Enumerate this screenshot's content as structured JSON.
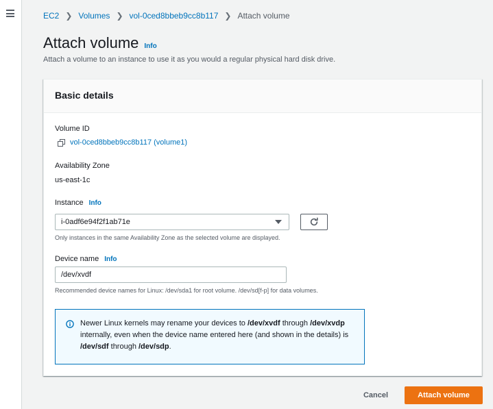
{
  "breadcrumb": [
    {
      "label": "EC2",
      "link": true
    },
    {
      "label": "Volumes",
      "link": true
    },
    {
      "label": "vol-0ced8bbeb9cc8b117",
      "link": true
    },
    {
      "label": "Attach volume",
      "link": false
    }
  ],
  "page": {
    "title": "Attach volume",
    "info": "Info",
    "description": "Attach a volume to an instance to use it as you would a regular physical hard disk drive."
  },
  "panel": {
    "title": "Basic details",
    "volume_id_label": "Volume ID",
    "volume_id_value": "vol-0ced8bbeb9cc8b117 (volume1)",
    "az_label": "Availability Zone",
    "az_value": "us-east-1c",
    "instance_label": "Instance",
    "instance_info": "Info",
    "instance_selected": "i-0adf6e94f2f1ab71e",
    "instance_hint": "Only instances in the same Availability Zone as the selected volume are displayed.",
    "device_label": "Device name",
    "device_info": "Info",
    "device_value": "/dev/xvdf",
    "device_hint": "Recommended device names for Linux: /dev/sda1 for root volume. /dev/sd[f-p] for data volumes.",
    "alert": {
      "t1": "Newer Linux kernels may rename your devices to ",
      "b1": "/dev/xvdf",
      "t2": " through ",
      "b2": "/dev/xvdp",
      "t3": " internally, even when the device name entered here (and shown in the details) is ",
      "b3": "/dev/sdf",
      "t4": " through ",
      "b4": "/dev/sdp",
      "t5": "."
    }
  },
  "actions": {
    "cancel": "Cancel",
    "attach": "Attach volume"
  },
  "colors": {
    "link": "#0073bb",
    "primary": "#ec7211",
    "background": "#f2f3f3"
  }
}
